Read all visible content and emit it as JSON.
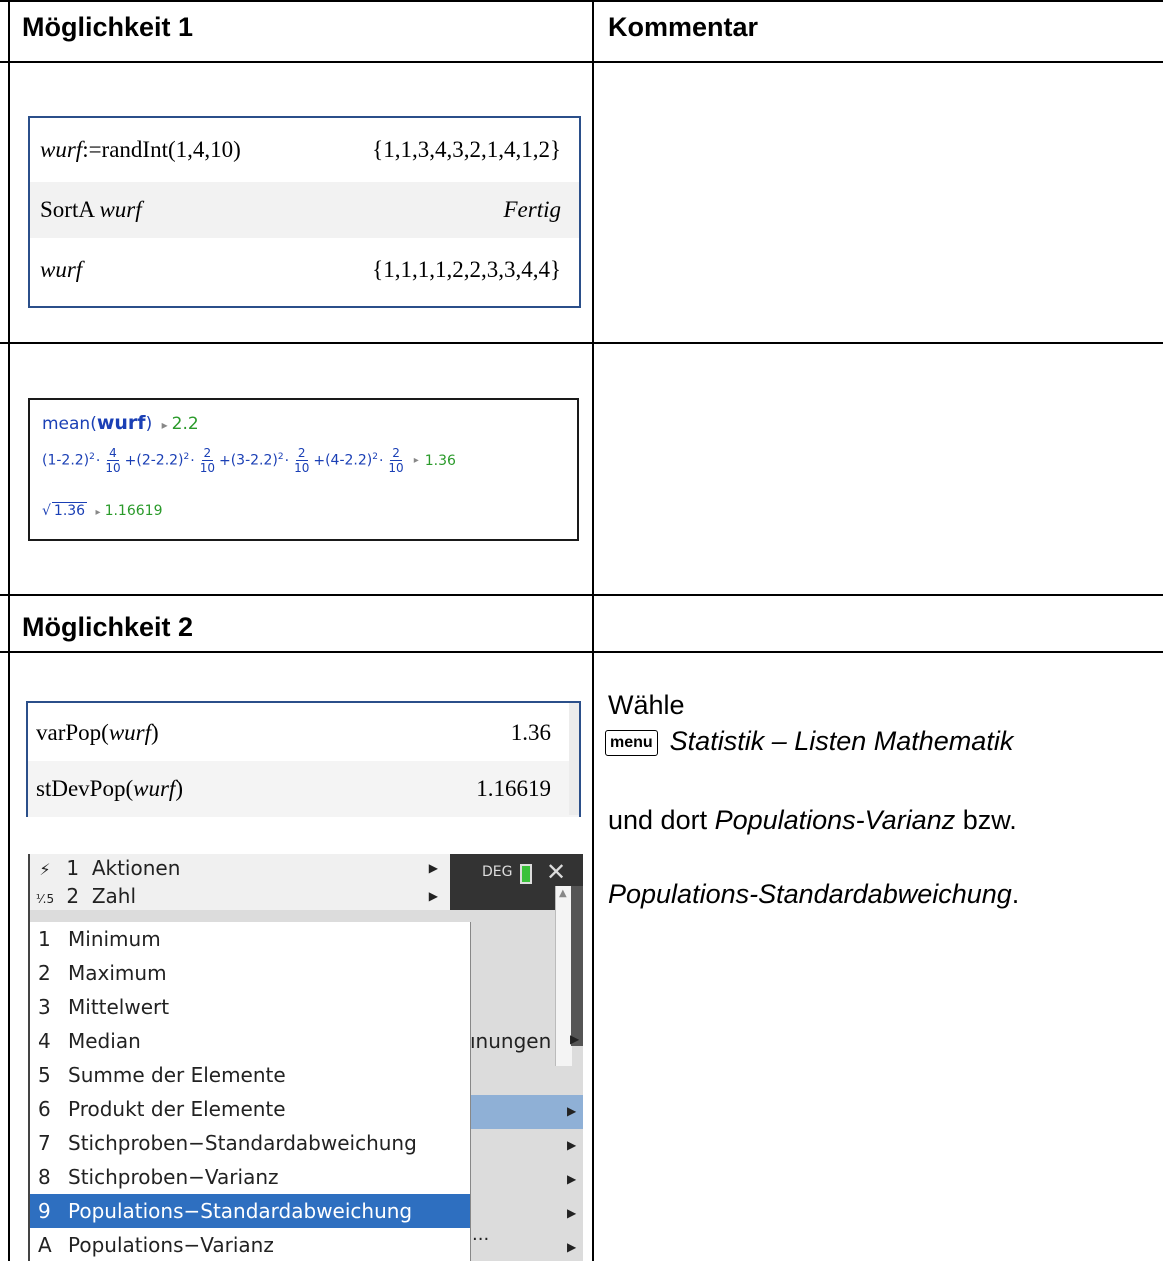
{
  "table": {
    "col1_header": "Möglichkeit 1",
    "col2_header": "Kommentar",
    "section2_header": "Möglichkeit 2"
  },
  "calc1": {
    "rows": [
      {
        "left_pre": "wurf",
        "left_rest": ":=randInt(1,4,10)",
        "right": "{1,1,3,4,3,2,1,4,1,2}"
      },
      {
        "left_pre": "SortA ",
        "left_var": "wurf",
        "right": "Fertig"
      },
      {
        "left_var": "wurf",
        "right": "{1,1,1,1,2,2,3,3,4,4}"
      }
    ]
  },
  "calc2": {
    "line1_fn": "mean(",
    "line1_arg": "wurf",
    "line1_close": ")",
    "line1_arrow": "▸",
    "line1_result": "2.2",
    "line2_terms": [
      {
        "base": "(1-2.2)",
        "exp": "2",
        "num": "4",
        "den": "10"
      },
      {
        "base": "(2-2.2)",
        "exp": "2",
        "num": "2",
        "den": "10"
      },
      {
        "base": "(3-2.2)",
        "exp": "2",
        "num": "2",
        "den": "10"
      },
      {
        "base": "(4-2.2)",
        "exp": "2",
        "num": "2",
        "den": "10"
      }
    ],
    "line2_result": "1.36",
    "line3_radicand": "1.36",
    "line3_result": "1.16619"
  },
  "calc3": {
    "rows": [
      {
        "fn": "varPop(",
        "arg": "wurf",
        "close": ")",
        "result": "1.36"
      },
      {
        "fn": "stDevPop(",
        "arg": "wurf",
        "close": ")",
        "result": "1.16619"
      }
    ]
  },
  "menu_shot": {
    "main_items": [
      {
        "num": "1",
        "label": "Aktionen",
        "icon": "⚡"
      },
      {
        "num": "2",
        "label": "Zahl",
        "icon": "⅟.5"
      }
    ],
    "status": {
      "angle_mode": "DEG"
    },
    "partial_label": "ınungen",
    "sub_items": [
      {
        "key": "1",
        "label": "Minimum"
      },
      {
        "key": "2",
        "label": "Maximum"
      },
      {
        "key": "3",
        "label": "Mittelwert"
      },
      {
        "key": "4",
        "label": "Median"
      },
      {
        "key": "5",
        "label": "Summe der Elemente"
      },
      {
        "key": "6",
        "label": "Produkt der Elemente"
      },
      {
        "key": "7",
        "label": "Stichproben−Standardabweichung"
      },
      {
        "key": "8",
        "label": "Stichproben−Varianz"
      },
      {
        "key": "9",
        "label": "Populations−Standardabweichung"
      },
      {
        "key": "A",
        "label": "Populations−Varianz"
      }
    ],
    "selected_index": 8,
    "ellipsis": "..."
  },
  "comment2": {
    "line1": "Wähle",
    "menu_key": "menu",
    "line2": "Statistik – Listen Mathematik",
    "line3_pre": "und dort ",
    "line3_em": "Populations-Varianz",
    "line3_post": " bzw.",
    "line4_em": "Populations-Standardabweichung",
    "line4_post": "."
  }
}
